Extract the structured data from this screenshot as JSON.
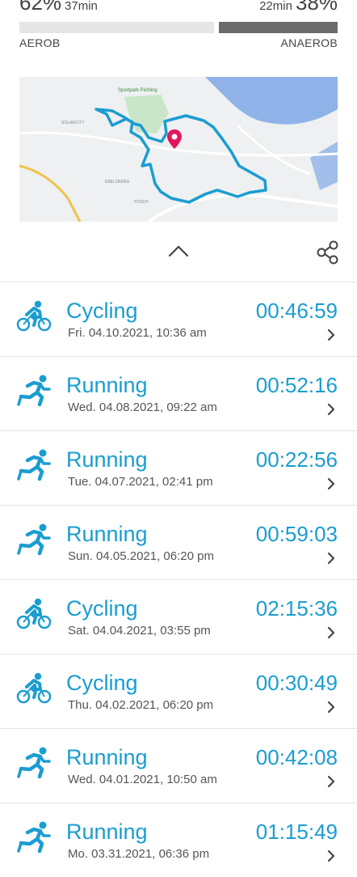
{
  "zones": {
    "aerob": {
      "percent": "62%",
      "minutes": "37min",
      "label": "AEROB",
      "fraction": 0.62
    },
    "anaerob": {
      "percent": "38%",
      "minutes": "22min",
      "label": "ANAEROB",
      "fraction": 0.38
    }
  },
  "map": {
    "labels": [
      "Sportpark Pichling",
      "SOLARCITY",
      "EBELSBERG",
      "POSCH"
    ],
    "route_color": "#1a9dd1",
    "pin_color": "#e0175c",
    "river_color": "#8fb3e8"
  },
  "colors": {
    "accent": "#1a9dd1"
  },
  "activities": [
    {
      "type": "Cycling",
      "icon": "cycling-icon",
      "date": "Fri. 04.10.2021, 10:36 am",
      "duration": "00:46:59"
    },
    {
      "type": "Running",
      "icon": "running-icon",
      "date": "Wed. 04.08.2021, 09:22 am",
      "duration": "00:52:16"
    },
    {
      "type": "Running",
      "icon": "running-icon",
      "date": "Tue. 04.07.2021, 02:41 pm",
      "duration": "00:22:56"
    },
    {
      "type": "Running",
      "icon": "running-icon",
      "date": "Sun. 04.05.2021, 06:20 pm",
      "duration": "00:59:03"
    },
    {
      "type": "Cycling",
      "icon": "cycling-icon",
      "date": "Sat. 04.04.2021, 03:55 pm",
      "duration": "02:15:36"
    },
    {
      "type": "Cycling",
      "icon": "cycling-icon",
      "date": "Thu. 04.02.2021, 06:20 pm",
      "duration": "00:30:49"
    },
    {
      "type": "Running",
      "icon": "running-icon",
      "date": "Wed. 04.01.2021, 10:50 am",
      "duration": "00:42:08"
    },
    {
      "type": "Running",
      "icon": "running-icon",
      "date": "Mo. 03.31.2021, 06:36 pm",
      "duration": "01:15:49"
    }
  ]
}
